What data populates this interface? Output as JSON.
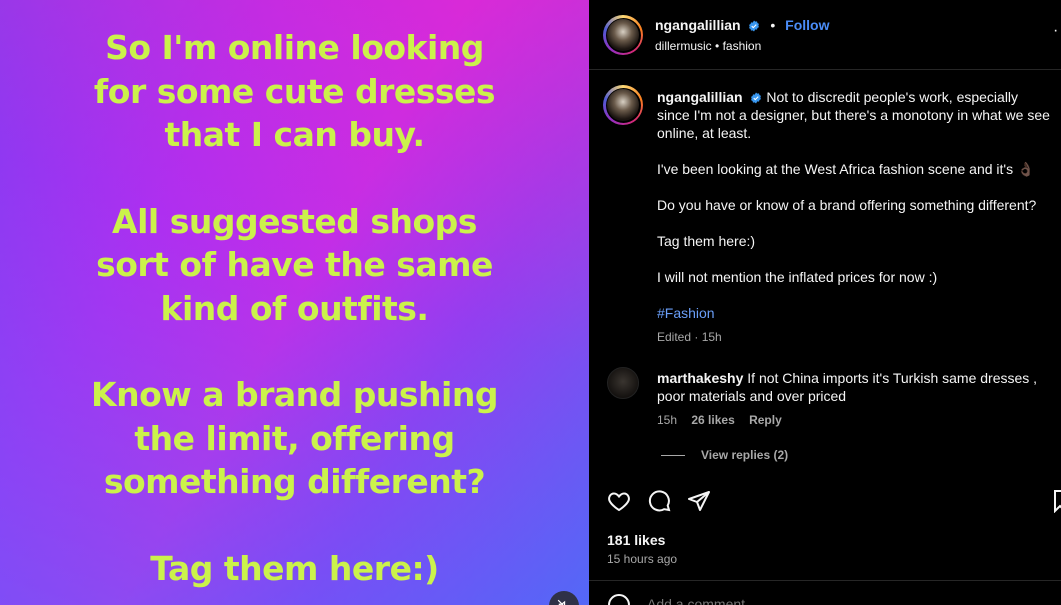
{
  "media": {
    "paragraphs": [
      [
        "So I'm online looking",
        "for some cute dresses",
        "that I can buy."
      ],
      [
        "All suggested shops",
        "sort of have the same",
        "kind of outfits."
      ],
      [
        "Know a brand pushing",
        "the limit, offering",
        "something different?"
      ],
      [
        "Tag them here:)"
      ]
    ],
    "text_color": "#cbf24b"
  },
  "header": {
    "username": "ngangalillian",
    "follow_label": "Follow",
    "audio": "dillermusic",
    "tag": "fashion"
  },
  "caption": {
    "username": "ngangalillian",
    "p1": "Not to discredit people's work, especially since I'm not a designer, but there's a monotony in what we see online, at least.",
    "p2": "I've been looking at the West Africa fashion scene and it's 👌🏿",
    "p3": "Do you have or know of a brand offering something different?",
    "p4": "Tag them here:)",
    "p5": "I will not mention the inflated prices for now :)",
    "hashtag": "#Fashion",
    "edited": "Edited · 15h"
  },
  "comment": {
    "username": "marthakeshy",
    "text": "If not China imports it's Turkish same dresses , poor materials and over priced",
    "time": "15h",
    "likes": "26 likes",
    "reply_label": "Reply",
    "view_replies": "View replies (2)"
  },
  "footer": {
    "likes": "181 likes",
    "time": "15 hours ago",
    "add_comment_placeholder": "Add a comment..."
  },
  "icons": [
    "heart-icon",
    "comment-icon",
    "share-icon",
    "save-icon",
    "verified-icon",
    "more-icon",
    "mute-icon",
    "emoji-icon"
  ]
}
